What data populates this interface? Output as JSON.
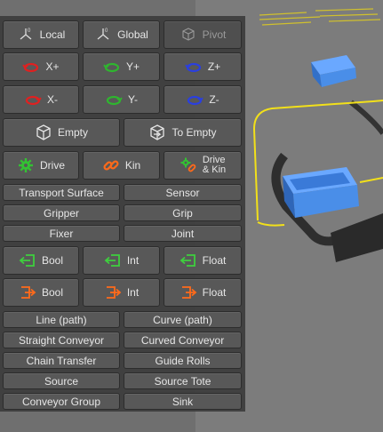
{
  "toolbar": {
    "space": {
      "local": "Local",
      "global": "Global",
      "pivot": "Pivot"
    },
    "axes_plus": {
      "x": "X+",
      "y": "Y+",
      "z": "Z+"
    },
    "axes_minus": {
      "x": "X-",
      "y": "Y-",
      "z": "Z-"
    },
    "empty": {
      "empty": "Empty",
      "to_empty": "To Empty"
    },
    "drives": {
      "drive": "Drive",
      "kin": "Kin",
      "drive_kin_1": "Drive",
      "drive_kin_2": "& Kin"
    },
    "components": [
      [
        "Transport Surface",
        "Sensor"
      ],
      [
        "Gripper",
        "Grip"
      ],
      [
        "Fixer",
        "Joint"
      ]
    ],
    "signals_in": {
      "bool": "Bool",
      "int": "Int",
      "float": "Float"
    },
    "signals_out": {
      "bool": "Bool",
      "int": "Int",
      "float": "Float"
    },
    "library": [
      [
        "Line (path)",
        "Curve (path)"
      ],
      [
        "Straight Conveyor",
        "Curved Conveyor"
      ],
      [
        "Chain Transfer",
        "Guide Rolls"
      ],
      [
        "Source",
        "Source Tote"
      ],
      [
        "Conveyor Group",
        "Sink"
      ]
    ]
  },
  "colors": {
    "axis_x": "#e02020",
    "axis_y": "#2fb52f",
    "axis_z": "#2a3fe0",
    "drive_green": "#33c233",
    "kin_orange": "#ff6a1a",
    "signal_in": "#3ecf3e",
    "signal_out": "#ff6a1a",
    "path_yellow": "#f2e01a",
    "box_blue": "#4a8ee8"
  }
}
